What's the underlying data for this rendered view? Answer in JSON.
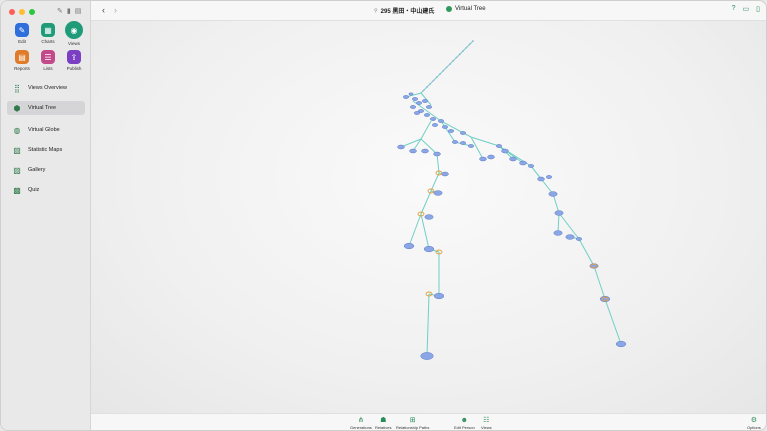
{
  "window": {
    "title": "295 黑田・中山建氏",
    "view_title": "Virtual Tree"
  },
  "sidebar": {
    "apps": [
      {
        "label": "Edit",
        "color": "#2f6fdc",
        "icon": "pencil-icon",
        "glyph": "✎"
      },
      {
        "label": "Charts",
        "color": "#1f9b7a",
        "icon": "charts-icon",
        "glyph": "▦"
      },
      {
        "label": "Views",
        "color": "#1f9b7a",
        "icon": "eye-icon",
        "glyph": "◉"
      },
      {
        "label": "Reports",
        "color": "#e07b2a",
        "icon": "reports-icon",
        "glyph": "▤"
      },
      {
        "label": "Lists",
        "color": "#c24a8a",
        "icon": "lists-icon",
        "glyph": "☰"
      },
      {
        "label": "Publish",
        "color": "#7a3fc2",
        "icon": "publish-icon",
        "glyph": "⇪"
      }
    ],
    "nav": [
      {
        "label": "Views Overview",
        "icon": "grid-icon",
        "glyph": "⣿"
      },
      {
        "label": "Virtual Tree",
        "icon": "tree-icon",
        "glyph": "⬢"
      },
      {
        "label": "Virtual Globe",
        "icon": "globe-icon",
        "glyph": "◍"
      },
      {
        "label": "Statistic Maps",
        "icon": "map-icon",
        "glyph": "▧"
      },
      {
        "label": "Gallery",
        "icon": "gallery-icon",
        "glyph": "▨"
      },
      {
        "label": "Quiz",
        "icon": "quiz-icon",
        "glyph": "▩"
      }
    ]
  },
  "bottombar": {
    "items": [
      {
        "label": "Generations",
        "icon": "generations-icon",
        "glyph": "⋔"
      },
      {
        "label": "Relatives",
        "icon": "relatives-icon",
        "glyph": "☗"
      },
      {
        "label": "Relationship Paths",
        "icon": "paths-icon",
        "glyph": "⊞"
      },
      {
        "label": "Edit Person",
        "icon": "person-icon",
        "glyph": "☻"
      },
      {
        "label": "Views",
        "icon": "views-icon",
        "glyph": "☷"
      },
      {
        "label": "Options",
        "icon": "options-icon",
        "glyph": "⚙"
      }
    ]
  },
  "colors": {
    "accent": "#2a8a5a",
    "selection": "#d5d5d7",
    "tree_line": "#6fcfc4",
    "node_fill": "#8aa6e6",
    "node_ring": "#e0a040"
  }
}
